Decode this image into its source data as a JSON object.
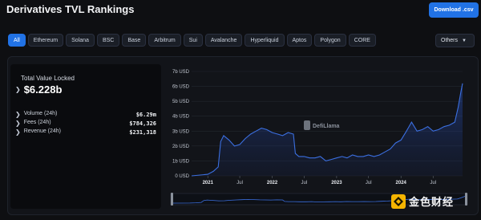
{
  "header": {
    "title": "Derivatives TVL Rankings",
    "download_label": "Download .csv"
  },
  "chains": [
    "All",
    "Ethereum",
    "Solana",
    "BSC",
    "Base",
    "Arbitrum",
    "Sui",
    "Avalanche",
    "Hyperliquid",
    "Aptos",
    "Polygon",
    "CORE"
  ],
  "active_chain": "All",
  "others_label": "Others",
  "stats": {
    "tvl_label": "Total Value Locked",
    "tvl_value": "$6.228b",
    "metrics": [
      {
        "label": "Volume (24h)",
        "value": "$6.29m"
      },
      {
        "label": "Fees (24h)",
        "value": "$784,326"
      },
      {
        "label": "Revenue (24h)",
        "value": "$231,318"
      }
    ]
  },
  "watermark": "DefiLlama",
  "source_badge": {
    "text": "金色财经"
  },
  "colors": {
    "accent": "#2172e5",
    "line": "#3b6fe0",
    "background": "#0e0f12"
  },
  "chart_data": {
    "type": "area",
    "title": "",
    "xlabel": "",
    "ylabel": "",
    "ylim": [
      0,
      7
    ],
    "y_unit": "b USD",
    "y_ticks": [
      "0 USD",
      "1b USD",
      "2b USD",
      "3b USD",
      "4b USD",
      "5b USD",
      "6b USD",
      "7b USD"
    ],
    "x_ticks": [
      {
        "label": "2021",
        "x": "2021-01-01",
        "major": true
      },
      {
        "label": "Jul",
        "x": "2021-07-01",
        "major": false
      },
      {
        "label": "2022",
        "x": "2022-01-01",
        "major": true
      },
      {
        "label": "Jul",
        "x": "2022-07-01",
        "major": false
      },
      {
        "label": "2023",
        "x": "2023-01-01",
        "major": true
      },
      {
        "label": "Jul",
        "x": "2023-07-01",
        "major": false
      },
      {
        "label": "2024",
        "x": "2024-01-01",
        "major": true
      },
      {
        "label": "Jul",
        "x": "2024-07-01",
        "major": false
      }
    ],
    "x_range": [
      "2020-10-01",
      "2024-12-15"
    ],
    "grid": true,
    "series": [
      {
        "points": [
          [
            "2020-10-01",
            0.0
          ],
          [
            "2021-01-01",
            0.1
          ],
          [
            "2021-02-01",
            0.3
          ],
          [
            "2021-03-01",
            0.6
          ],
          [
            "2021-03-15",
            2.3
          ],
          [
            "2021-04-01",
            2.7
          ],
          [
            "2021-05-01",
            2.4
          ],
          [
            "2021-06-01",
            2.0
          ],
          [
            "2021-07-01",
            2.1
          ],
          [
            "2021-08-01",
            2.5
          ],
          [
            "2021-09-01",
            2.8
          ],
          [
            "2021-10-01",
            3.0
          ],
          [
            "2021-11-01",
            3.2
          ],
          [
            "2021-12-01",
            3.1
          ],
          [
            "2022-01-01",
            2.9
          ],
          [
            "2022-02-01",
            2.8
          ],
          [
            "2022-03-01",
            2.7
          ],
          [
            "2022-04-01",
            2.9
          ],
          [
            "2022-05-01",
            2.8
          ],
          [
            "2022-05-12",
            1.5
          ],
          [
            "2022-06-01",
            1.3
          ],
          [
            "2022-07-01",
            1.3
          ],
          [
            "2022-08-01",
            1.2
          ],
          [
            "2022-09-01",
            1.2
          ],
          [
            "2022-10-01",
            1.3
          ],
          [
            "2022-11-01",
            1.0
          ],
          [
            "2022-12-01",
            1.1
          ],
          [
            "2023-01-01",
            1.2
          ],
          [
            "2023-02-01",
            1.3
          ],
          [
            "2023-03-01",
            1.2
          ],
          [
            "2023-04-01",
            1.4
          ],
          [
            "2023-05-01",
            1.3
          ],
          [
            "2023-06-01",
            1.3
          ],
          [
            "2023-07-01",
            1.4
          ],
          [
            "2023-08-01",
            1.3
          ],
          [
            "2023-09-01",
            1.4
          ],
          [
            "2023-10-01",
            1.6
          ],
          [
            "2023-11-01",
            1.8
          ],
          [
            "2023-12-01",
            2.2
          ],
          [
            "2024-01-01",
            2.4
          ],
          [
            "2024-02-01",
            3.0
          ],
          [
            "2024-03-01",
            3.6
          ],
          [
            "2024-04-01",
            3.0
          ],
          [
            "2024-05-01",
            3.1
          ],
          [
            "2024-06-01",
            3.3
          ],
          [
            "2024-07-01",
            3.0
          ],
          [
            "2024-08-01",
            3.1
          ],
          [
            "2024-09-01",
            3.3
          ],
          [
            "2024-10-01",
            3.4
          ],
          [
            "2024-11-01",
            3.6
          ],
          [
            "2024-11-20",
            4.6
          ],
          [
            "2024-12-05",
            5.6
          ],
          [
            "2024-12-15",
            6.2
          ]
        ]
      }
    ]
  }
}
